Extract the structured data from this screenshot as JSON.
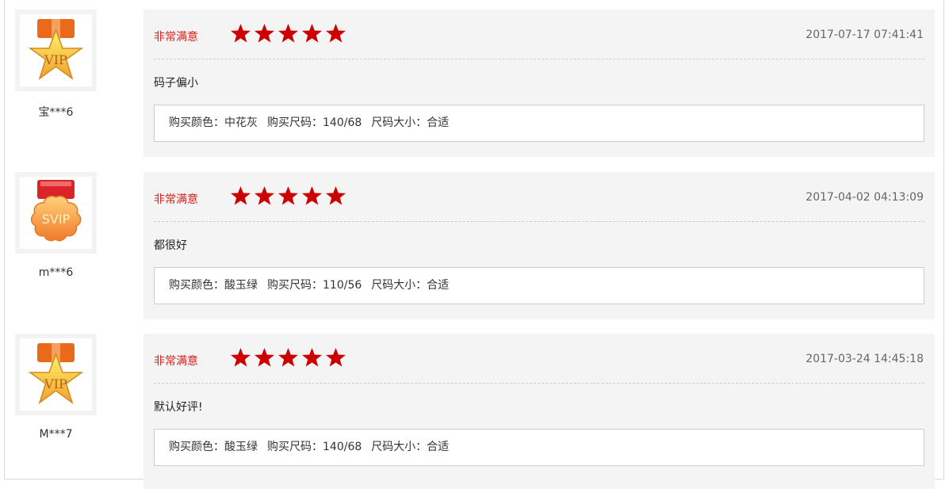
{
  "reviews": [
    {
      "badge": "VIP",
      "badge_color": "#f0a030",
      "ribbon_color": "#e86a1a",
      "username": "宝***6",
      "rating_text": "非常满意",
      "stars": 5,
      "date": "2017-07-17 07:41:41",
      "comment": "码子偏小",
      "specs": [
        "购买颜色：中花灰",
        "购买尺码：140/68",
        "尺码大小：合适"
      ]
    },
    {
      "badge": "SVIP",
      "badge_color": "#f08a3a",
      "ribbon_color": "#d9252a",
      "username": "m***6",
      "rating_text": "非常满意",
      "stars": 5,
      "date": "2017-04-02 04:13:09",
      "comment": "都很好",
      "specs": [
        "购买颜色：酸玉绿",
        "购买尺码：110/56",
        "尺码大小：合适"
      ]
    },
    {
      "badge": "VIP",
      "badge_color": "#f0a030",
      "ribbon_color": "#e86a1a",
      "username": "M***7",
      "rating_text": "非常满意",
      "stars": 5,
      "date": "2017-03-24 14:45:18",
      "comment": "默认好评!",
      "specs": [
        "购买颜色：酸玉绿",
        "购买尺码：140/68",
        "尺码大小：合适"
      ]
    }
  ],
  "colors": {
    "accent": "#d9201b",
    "star": "#cc0000",
    "panel_bg": "#f4f4f4"
  }
}
